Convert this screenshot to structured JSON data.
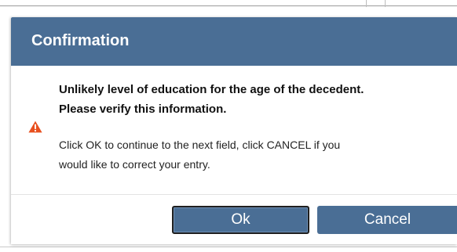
{
  "dialog": {
    "title": "Confirmation",
    "icon": "warning-triangle-icon",
    "icon_color": "#e8501f",
    "header_color": "#4a6e95",
    "message_primary": [
      "Unlikely level of education for the age of the decedent.",
      "Please verify this information."
    ],
    "message_secondary": [
      "Click OK to continue to the next field, click CANCEL if you",
      "would like to correct your entry."
    ],
    "buttons": {
      "ok_label": "Ok",
      "cancel_label": "Cancel"
    }
  }
}
